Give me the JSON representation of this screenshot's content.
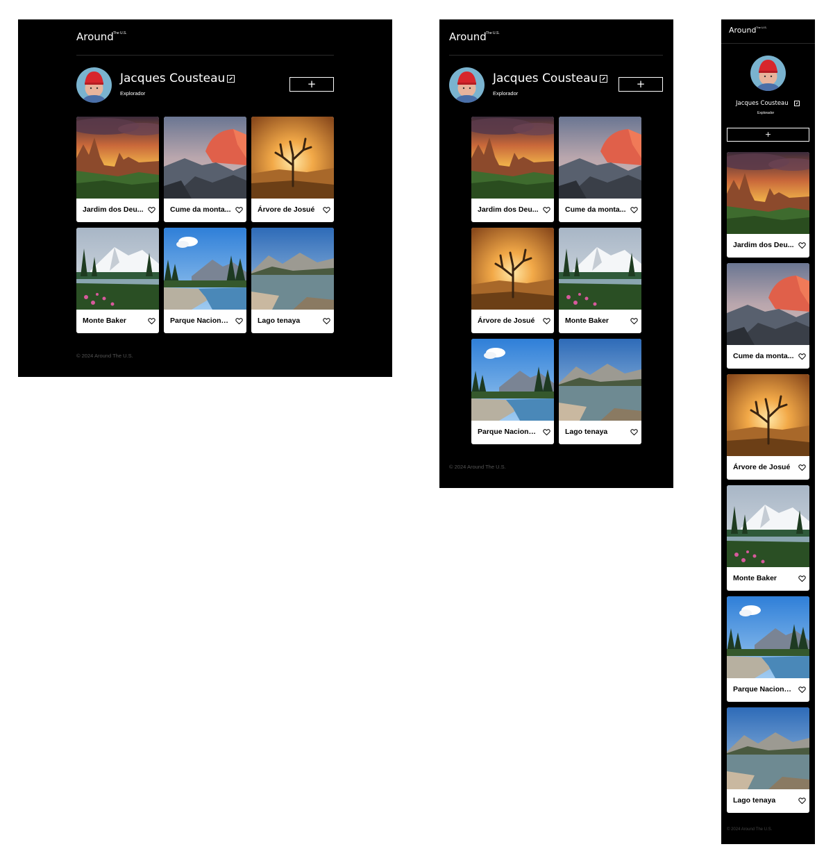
{
  "brand": {
    "name": "Around",
    "superscript": "The U.S."
  },
  "profile": {
    "name": "Jacques Cousteau",
    "role": "Explorador"
  },
  "add_button_label": "+",
  "cards": [
    {
      "title": "Jardim dos Deuses",
      "display": "Jardim dos Deu...",
      "scene": "garden"
    },
    {
      "title": "Cume da montanha",
      "display": "Cume da monta...",
      "scene": "halfdome"
    },
    {
      "title": "Árvore de Josué",
      "display": "Árvore de Josué",
      "scene": "joshua"
    },
    {
      "title": "Monte Baker",
      "display": "Monte Baker",
      "scene": "baker"
    },
    {
      "title": "Parque Nacional",
      "display": "Parque Nacional...",
      "scene": "park"
    },
    {
      "title": "Lago tenaya",
      "display": "Lago tenaya",
      "scene": "lake"
    }
  ],
  "footer": "© 2024 Around The U.S.",
  "icons": {
    "heart": "heart-outline-icon",
    "edit": "edit-pencil-icon",
    "add": "plus-icon"
  }
}
